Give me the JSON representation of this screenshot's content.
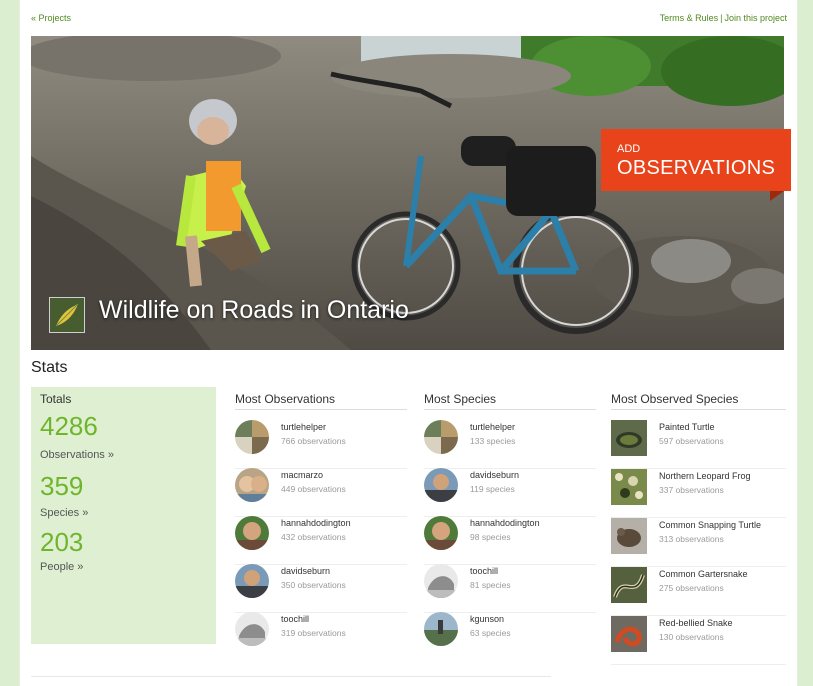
{
  "nav": {
    "back_link": "« Projects",
    "terms_link": "Terms & Rules",
    "separator": "|",
    "join_link": "Join this project"
  },
  "hero": {
    "title": "Wildlife on Roads in Ontario",
    "add_button_line1": "ADD",
    "add_button_line2": "OBSERVATIONS"
  },
  "stats": {
    "heading": "Stats",
    "totals": {
      "heading": "Totals",
      "observations_count": "4286",
      "observations_label": "Observations »",
      "species_count": "359",
      "species_label": "Species »",
      "people_count": "203",
      "people_label": "People »"
    },
    "most_observations": {
      "heading": "Most Observations",
      "rows": [
        {
          "name": "turtlehelper",
          "detail": "766 observations"
        },
        {
          "name": "macmarzo",
          "detail": "449 observations"
        },
        {
          "name": "hannahdodington",
          "detail": "432 observations"
        },
        {
          "name": "davidseburn",
          "detail": "350 observations"
        },
        {
          "name": "toochill",
          "detail": "319 observations"
        }
      ]
    },
    "most_species": {
      "heading": "Most Species",
      "rows": [
        {
          "name": "turtlehelper",
          "detail": "133 species"
        },
        {
          "name": "davidseburn",
          "detail": "119 species"
        },
        {
          "name": "hannahdodington",
          "detail": "98 species"
        },
        {
          "name": "toochill",
          "detail": "81 species"
        },
        {
          "name": "kgunson",
          "detail": "63 species"
        }
      ]
    },
    "most_observed_species": {
      "heading": "Most Observed Species",
      "rows": [
        {
          "name": "Painted Turtle",
          "detail": "597 observations"
        },
        {
          "name": "Northern Leopard Frog",
          "detail": "337 observations"
        },
        {
          "name": "Common Snapping Turtle",
          "detail": "313 observations"
        },
        {
          "name": "Common Gartersnake",
          "detail": "275 observations"
        },
        {
          "name": "Red-bellied Snake",
          "detail": "130 observations"
        }
      ]
    }
  },
  "colors": {
    "accent_green": "#6fb52c",
    "link_green": "#4f8a1e",
    "add_button": "#e8431a",
    "totals_bg": "#dff0d2"
  }
}
